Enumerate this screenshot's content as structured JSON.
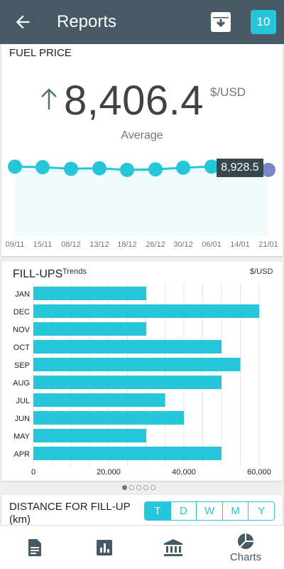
{
  "header": {
    "title": "Reports",
    "badge": "10"
  },
  "fuel": {
    "label": "FUEL PRICE",
    "value": "8,406.4",
    "unit": "$/USD",
    "caption": "Average",
    "tooltip": "8,928.5"
  },
  "fillups": {
    "label": "FILL-UPS",
    "trends": "Trends",
    "unit": "$/USD"
  },
  "distance": {
    "label_line1": "DISTANCE FOR FILL-UP",
    "label_line2": "(km)"
  },
  "period_options": [
    "T",
    "D",
    "W",
    "M",
    "Y"
  ],
  "nav": {
    "charts_label": "Charts"
  },
  "colors": {
    "appbar": "#455a64",
    "accent": "#26c6da",
    "area": "#f1fcfd"
  },
  "chart_data": [
    {
      "type": "line",
      "title": "FUEL PRICE",
      "x": [
        "09/11",
        "15/11",
        "08/12",
        "13/12",
        "18/12",
        "26/12",
        "30/12",
        "06/01",
        "14/01",
        "21/01"
      ],
      "values": [
        8440,
        8430,
        8400,
        8410,
        8380,
        8390,
        8420,
        8440,
        8928.5,
        8380
      ],
      "highlight": {
        "index": 8,
        "label": "8,928.5"
      }
    },
    {
      "type": "bar",
      "orientation": "horizontal",
      "title": "FILL-UPS",
      "categories": [
        "JAN",
        "DEC",
        "NOV",
        "OCT",
        "SEP",
        "AUG",
        "JUL",
        "JUN",
        "MAY",
        "APR"
      ],
      "values": [
        30000,
        60000,
        30000,
        50000,
        55000,
        50000,
        35000,
        40000,
        30000,
        50000
      ],
      "xticks": [
        "0",
        "20,000",
        "40,000",
        "60,000"
      ],
      "xlim": [
        0,
        60000
      ],
      "grid": true
    }
  ]
}
